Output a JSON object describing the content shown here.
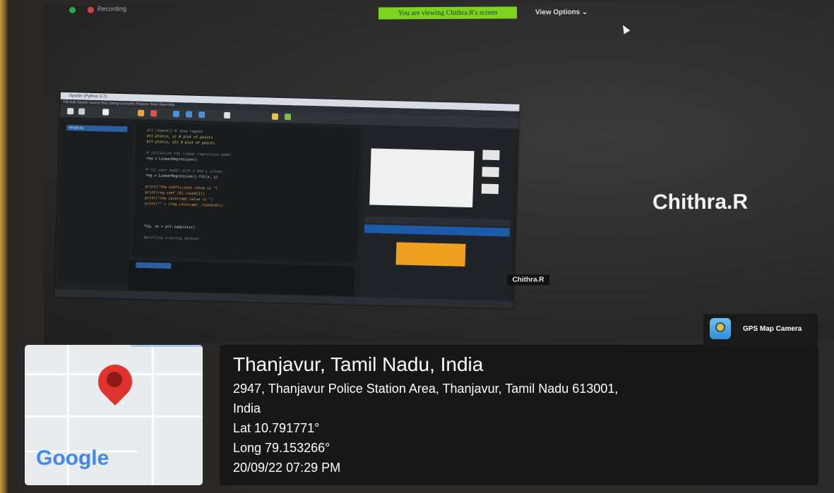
{
  "screen": {
    "recording_label": "Recording",
    "viewing_banner": "You are viewing Chithra.R's screen",
    "view_options": "View Options ⌄",
    "presenter_name": "Chithra.R",
    "presenter_tile": "Chithra.R"
  },
  "spyder": {
    "title": "Spyder (Python 3.7)",
    "menu": "File  Edit  Search  Source  Run  Debug  Consoles  Projects  Tools  View  Help",
    "file": "simple.py",
    "code_lines": [
      "plt.legend() # show legend",
      "plt.plot(x, y)   # plot of points",
      "plt.plot(x, y2)  # plot of points",
      "",
      "# initialize the linear regression model",
      "reg = LinearRegression()",
      "",
      "# fit your model with x and y values",
      "reg = LinearRegression().fit(x, y)",
      "",
      "print(\"the coefficient value is \")",
      "print(reg.coef_[0].round(2))",
      "print(\"the intercept value is \")",
      "print(\"\" + (reg.intercept_.round(0)))",
      "",
      "",
      "fig, ax = plt.subplots()",
      "",
      "#plotting training dataset"
    ]
  },
  "gps": {
    "app_name": "GPS Map Camera",
    "map_logo": "Google",
    "place": "Thanjavur, Tamil Nadu, India",
    "address_line1": "2947, Thanjavur Police Station Area, Thanjavur, Tamil Nadu 613001,",
    "address_line2": "India",
    "lat": "Lat 10.791771°",
    "long": "Long 79.153266°",
    "datetime": "20/09/22 07:29 PM"
  },
  "colors": {
    "banner": "#7ed321",
    "pin": "#e0332f",
    "editor_bg": "#191b1d"
  }
}
